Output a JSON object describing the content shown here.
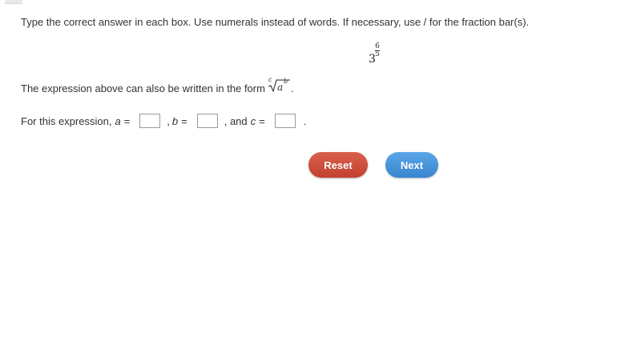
{
  "instructions": "Type the correct answer in each box. Use numerals instead of words. If necessary, use / for the fraction bar(s).",
  "expression": {
    "base": "3",
    "exponent_numerator": "6",
    "exponent_denominator": "5"
  },
  "statement": {
    "text": "The expression above can also be written in the form",
    "radical_index": "c",
    "radicand": "a",
    "radicand_exponent": "b",
    "period": "."
  },
  "answer_row": {
    "prefix": "For this expression,",
    "var_a": "a",
    "equals_a": "=",
    "sep_b": ",",
    "var_b": "b",
    "equals_b": "=",
    "sep_c": ", and",
    "var_c": "c",
    "equals_c": "=",
    "suffix": ".",
    "box_a_value": "",
    "box_b_value": "",
    "box_c_value": ""
  },
  "buttons": {
    "reset_label": "Reset",
    "next_label": "Next",
    "reset_color": "#c9483a",
    "next_color": "#4a95db"
  }
}
